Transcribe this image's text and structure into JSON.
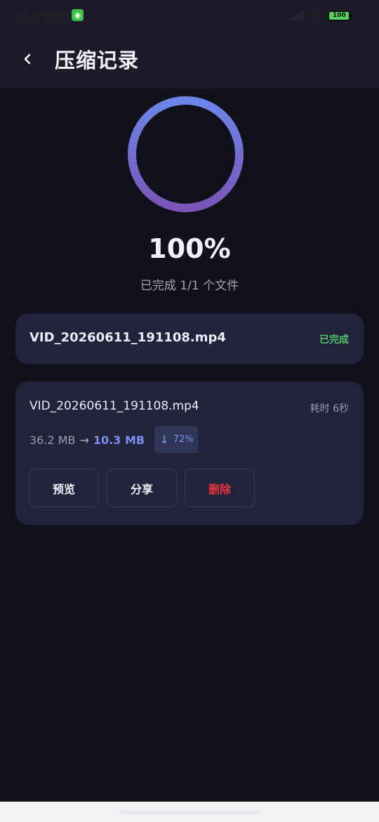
{
  "status_bar": {
    "time": "晚上7:09",
    "battery": "100",
    "app_icon": "wechat-icon"
  },
  "header": {
    "title": "压缩记录",
    "back_icon": "chevron-left-icon"
  },
  "progress": {
    "value": 1.0,
    "percent_text": "100%",
    "subtitle": "已完成 1/1 个文件",
    "ring_colors": [
      "#7b55b8",
      "#6b86e8"
    ]
  },
  "file_item": {
    "name": "VID_20260611_191108.mp4",
    "status": "已完成",
    "status_color": "#4fc36a"
  },
  "result": {
    "name": "VID_20260611_191108.mp4",
    "duration": "耗时 6秒",
    "original_size": "36.2 MB",
    "arrow": "→",
    "compressed_size": "10.3 MB",
    "reduction_icon": "↓",
    "reduction": "72%",
    "actions": {
      "preview": "预览",
      "share": "分享",
      "delete": "删除"
    }
  },
  "colors": {
    "background": "#11111b",
    "card": "#22223a",
    "accent": "#7c8ef0",
    "danger": "#e8383f"
  }
}
